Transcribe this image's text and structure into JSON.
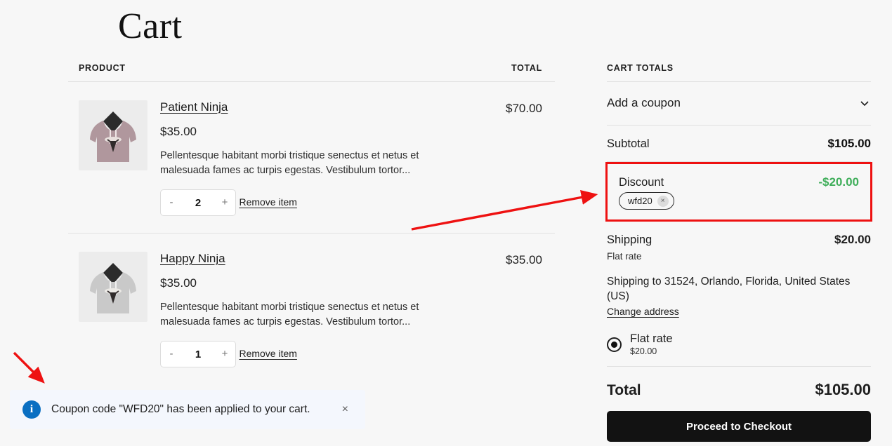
{
  "page": {
    "title": "Cart"
  },
  "items_table": {
    "header": {
      "product": "PRODUCT",
      "total": "TOTAL"
    },
    "rows": [
      {
        "name": "Patient Ninja",
        "price": "$35.00",
        "description": "Pellentesque habitant morbi tristique senectus et netus et malesuada fames ac turpis egestas. Vestibulum tortor...",
        "qty": "2",
        "minus": "-",
        "plus": "+",
        "remove_label": "Remove item",
        "line_total": "$70.00",
        "thumb_color": "#b0979d"
      },
      {
        "name": "Happy Ninja",
        "price": "$35.00",
        "description": "Pellentesque habitant morbi tristique senectus et netus et malesuada fames ac turpis egestas. Vestibulum tortor...",
        "qty": "1",
        "minus": "-",
        "plus": "+",
        "remove_label": "Remove item",
        "line_total": "$35.00",
        "thumb_color": "#c9c9c9"
      }
    ]
  },
  "totals": {
    "title": "CART TOTALS",
    "coupon_toggle": "Add a coupon",
    "subtotal": {
      "label": "Subtotal",
      "value": "$105.00"
    },
    "discount": {
      "label": "Discount",
      "value": "-$20.00",
      "coupon_code": "wfd20",
      "remove_symbol": "×",
      "value_color": "#3fae5a",
      "highlight_color": "#ee1111"
    },
    "shipping": {
      "label": "Shipping",
      "value": "$20.00",
      "method": "Flat rate",
      "destination": "Shipping to 31524, Orlando, Florida, United States (US)",
      "change_address": "Change address",
      "option_name": "Flat rate",
      "option_price": "$20.00"
    },
    "total": {
      "label": "Total",
      "value": "$105.00"
    },
    "checkout_label": "Proceed to Checkout"
  },
  "toast": {
    "icon_glyph": "i",
    "message": "Coupon code \"WFD20\" has been applied to your cart.",
    "close_symbol": "×",
    "accent_color": "#0a6fc2",
    "background": "#f4f7fd"
  }
}
